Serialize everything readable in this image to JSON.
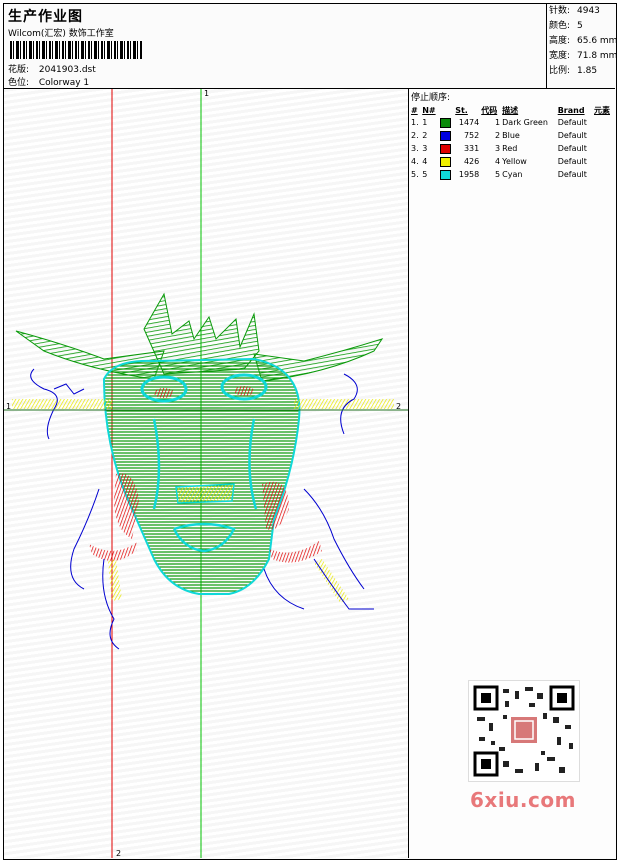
{
  "header": {
    "title": "生产作业图",
    "studio": "Wilcom(汇宏) 数饰工作室",
    "design_label": "花版:",
    "design_value": "2041903.dst",
    "colorway_label": "色位:",
    "colorway_value": "Colorway 1"
  },
  "stats": [
    {
      "label": "针数:",
      "value": "4943"
    },
    {
      "label": "颜色:",
      "value": "5"
    },
    {
      "label": "高度:",
      "value": "65.6 mm"
    },
    {
      "label": "宽度:",
      "value": "71.8 mm"
    },
    {
      "label": "比例:",
      "value": "1.85"
    }
  ],
  "sequence": {
    "title": "停止顺序:",
    "columns": [
      "#",
      "N#",
      "St.",
      "代码",
      "描述",
      "Brand",
      "元素"
    ],
    "rows": [
      {
        "num": "1.",
        "n": "1",
        "color": "#0a8a0a",
        "st": "1474",
        "code": "1",
        "desc": "Dark Green",
        "brand": "Default"
      },
      {
        "num": "2.",
        "n": "2",
        "color": "#0000e0",
        "st": "752",
        "code": "2",
        "desc": "Blue",
        "brand": "Default"
      },
      {
        "num": "3.",
        "n": "3",
        "color": "#e00000",
        "st": "331",
        "code": "3",
        "desc": "Red",
        "brand": "Default"
      },
      {
        "num": "4.",
        "n": "4",
        "color": "#f0f000",
        "st": "426",
        "code": "4",
        "desc": "Yellow",
        "brand": "Default"
      },
      {
        "num": "5.",
        "n": "5",
        "color": "#10d8d8",
        "st": "1958",
        "code": "5",
        "desc": "Cyan",
        "brand": "Default"
      }
    ]
  },
  "axes": {
    "v1_top": "1",
    "h1_left": "1",
    "h2_right": "2",
    "v2_bottom": "2"
  },
  "watermark": "6xiu.com"
}
